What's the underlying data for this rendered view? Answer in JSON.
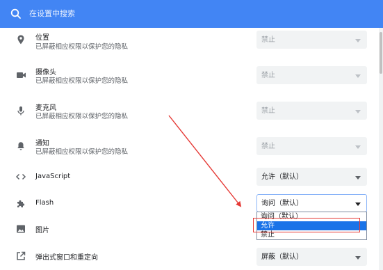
{
  "search": {
    "placeholder": "在设置中搜索"
  },
  "rows": [
    {
      "title": "位置",
      "desc": "已屏蔽相应权限以保护您的隐私",
      "value": "禁止",
      "icon": "location-pin-icon"
    },
    {
      "title": "摄像头",
      "desc": "已屏蔽相应权限以保护您的隐私",
      "value": "禁止",
      "icon": "camera-icon"
    },
    {
      "title": "麦克风",
      "desc": "已屏蔽相应权限以保护您的隐私",
      "value": "禁止",
      "icon": "microphone-icon"
    },
    {
      "title": "通知",
      "desc": "已屏蔽相应权限以保护您的隐私",
      "value": "禁止",
      "icon": "bell-icon"
    },
    {
      "title": "JavaScript",
      "value": "允许（默认）",
      "icon": "code-icon"
    },
    {
      "title": "Flash",
      "value": "询问（默认）",
      "icon": "puzzle-icon"
    },
    {
      "title": "图片",
      "icon": "image-icon"
    },
    {
      "title": "弹出式窗口和重定向",
      "value": "屏蔽（默认）",
      "icon": "popup-icon"
    }
  ],
  "dropdown": {
    "options": [
      "询问（默认）",
      "允许",
      "禁止"
    ],
    "selected_index": 1
  },
  "colors": {
    "header": "#4285f4",
    "selection": "#1a73e8",
    "annotation": "#e53935"
  }
}
